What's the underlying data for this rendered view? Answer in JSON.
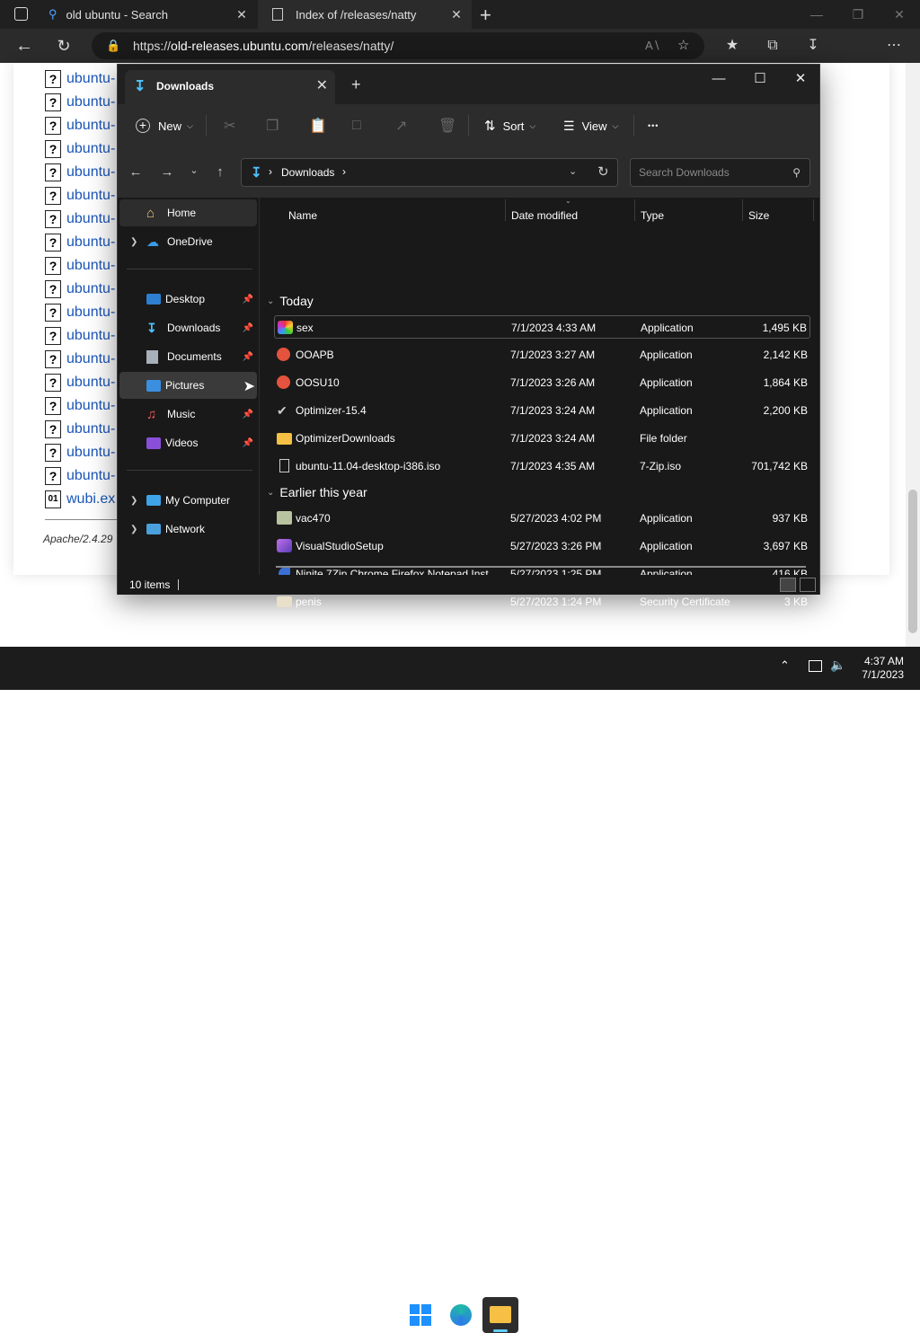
{
  "browser": {
    "tabs": [
      {
        "label": "old ubuntu - Search",
        "icon": "search-icon"
      },
      {
        "label": "Index of /releases/natty",
        "icon": "page-icon"
      }
    ],
    "url": {
      "prefix": "https://",
      "host": "old-releases.ubuntu.com",
      "path": "/releases/natty/"
    }
  },
  "webpage": {
    "rows": [
      "ubuntu-",
      "ubuntu-",
      "ubuntu-",
      "ubuntu-",
      "ubuntu-",
      "ubuntu-",
      "ubuntu-",
      "ubuntu-",
      "ubuntu-",
      "ubuntu-",
      "ubuntu-",
      "ubuntu-",
      "ubuntu-",
      "ubuntu-",
      "ubuntu-",
      "ubuntu-",
      "ubuntu-",
      "ubuntu-"
    ],
    "last_row": "wubi.ex",
    "footer": "Apache/2.4.29"
  },
  "explorer": {
    "tab_title": "Downloads",
    "toolbar": {
      "new": "New",
      "sort": "Sort",
      "view": "View",
      "more": "•••"
    },
    "breadcrumb": {
      "folder": "Downloads"
    },
    "search_placeholder": "Search Downloads",
    "nav": {
      "home": "Home",
      "onedrive": "OneDrive",
      "desktop": "Desktop",
      "downloads": "Downloads",
      "documents": "Documents",
      "pictures": "Pictures",
      "music": "Music",
      "videos": "Videos",
      "mycomputer": "My Computer",
      "network": "Network"
    },
    "columns": {
      "name": "Name",
      "date": "Date modified",
      "type": "Type",
      "size": "Size"
    },
    "groups": {
      "today": "Today",
      "earlier": "Earlier this year"
    },
    "files_today": [
      {
        "name": "sex",
        "date": "7/1/2023 4:33 AM",
        "type": "Application",
        "size": "1,495 KB"
      },
      {
        "name": "OOAPB",
        "date": "7/1/2023 3:27 AM",
        "type": "Application",
        "size": "2,142 KB"
      },
      {
        "name": "OOSU10",
        "date": "7/1/2023 3:26 AM",
        "type": "Application",
        "size": "1,864 KB"
      },
      {
        "name": "Optimizer-15.4",
        "date": "7/1/2023 3:24 AM",
        "type": "Application",
        "size": "2,200 KB"
      },
      {
        "name": "OptimizerDownloads",
        "date": "7/1/2023 3:24 AM",
        "type": "File folder",
        "size": ""
      },
      {
        "name": "ubuntu-11.04-desktop-i386.iso",
        "date": "7/1/2023 4:35 AM",
        "type": "7-Zip.iso",
        "size": "701,742 KB"
      }
    ],
    "files_earlier": [
      {
        "name": "vac470",
        "date": "5/27/2023 4:02 PM",
        "type": "Application",
        "size": "937 KB"
      },
      {
        "name": "VisualStudioSetup",
        "date": "5/27/2023 3:26 PM",
        "type": "Application",
        "size": "3,697 KB"
      },
      {
        "name": "Ninite 7Zip Chrome Firefox Notepad Inst...",
        "date": "5/27/2023 1:25 PM",
        "type": "Application",
        "size": "416 KB"
      },
      {
        "name": "penis",
        "date": "5/27/2023 1:24 PM",
        "type": "Security Certificate",
        "size": "3 KB"
      }
    ],
    "status": "10 items"
  },
  "taskbar": {
    "time": "4:37 AM",
    "date": "7/1/2023"
  },
  "colors": {
    "accent": "#60cdff",
    "folder": "#f5c043",
    "win_blue": "#1e90ff"
  }
}
